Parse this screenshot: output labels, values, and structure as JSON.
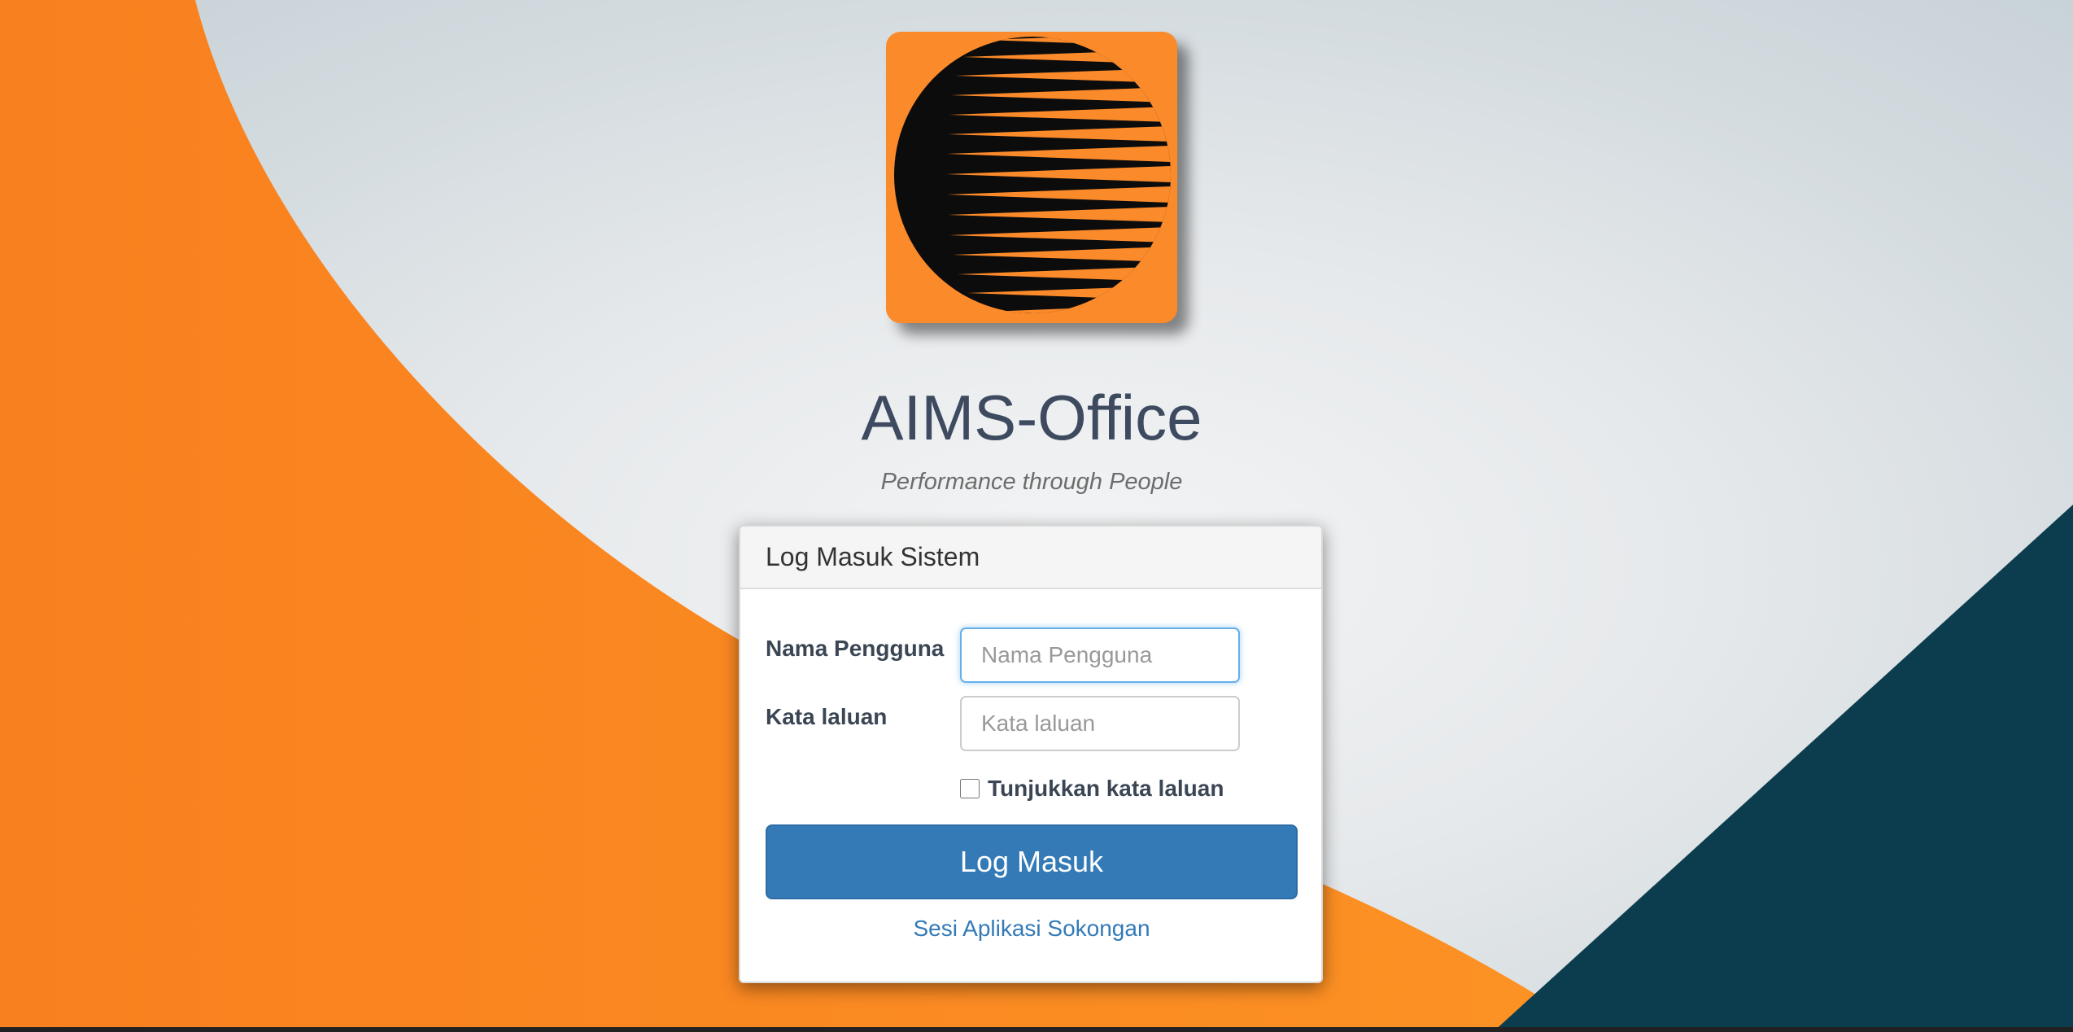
{
  "app": {
    "title": "AIMS-Office",
    "tagline": "Performance through People"
  },
  "login": {
    "heading": "Log Masuk Sistem",
    "username_label": "Nama Pengguna",
    "username_placeholder": "Nama Pengguna",
    "username_value": "",
    "password_label": "Kata laluan",
    "password_placeholder": "Kata laluan",
    "password_value": "",
    "show_password_label": "Tunjukkan kata laluan",
    "show_password_checked": false,
    "submit_label": "Log Masuk",
    "support_link": "Sesi Aplikasi Sokongan"
  },
  "colors": {
    "brand_orange": "#fb8a2a",
    "dark_teal": "#0b3d4e",
    "button_blue": "#337ab7",
    "title_text": "#3d4a5f"
  }
}
